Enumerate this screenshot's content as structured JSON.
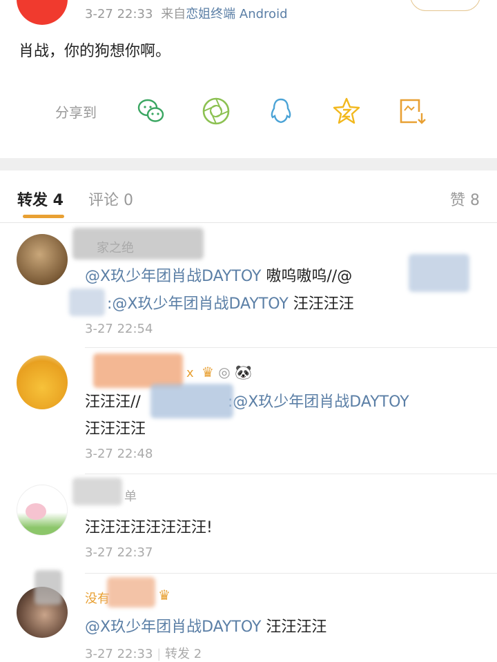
{
  "post": {
    "meta_time": "3-27 22:33",
    "meta_from": "来自",
    "meta_source": "恋姐终端 Android",
    "text": "肖战，你的狗想你啊。",
    "avatar_color": "#f03a2e"
  },
  "share": {
    "label": "分享到",
    "icons": [
      "wechat-icon",
      "moments-icon",
      "qq-icon",
      "qzone-icon",
      "save-image-icon"
    ]
  },
  "tabs": {
    "repost": "转发 4",
    "comment": "评论 0",
    "like": "赞 8",
    "accent": "#e8a033"
  },
  "reposts": [
    {
      "name": "家之绝",
      "line1_link": "@X玖少年团肖战DAYTOY",
      "line1_text": " 嗷呜嗷呜//@",
      "line2_link": ":@X玖少年团肖战DAYTOY",
      "line2_text": " 汪汪汪汪",
      "time": "3-27 22:54"
    },
    {
      "name": "x",
      "line1_text": "汪汪汪//",
      "line1_link": ":@X玖少年团肖战DAYTOY",
      "line2_text": "汪汪汪汪",
      "time": "3-27 22:48"
    },
    {
      "name": "单",
      "line1_text": "汪汪汪汪汪汪汪汪!",
      "time": "3-27 22:37"
    },
    {
      "name": "没有",
      "line1_link": "@X玖少年团肖战DAYTOY",
      "line1_text": " 汪汪汪汪",
      "time": "3-27 22:33",
      "repost_count": "转发 2"
    }
  ],
  "link_color": "#5b7fa6"
}
